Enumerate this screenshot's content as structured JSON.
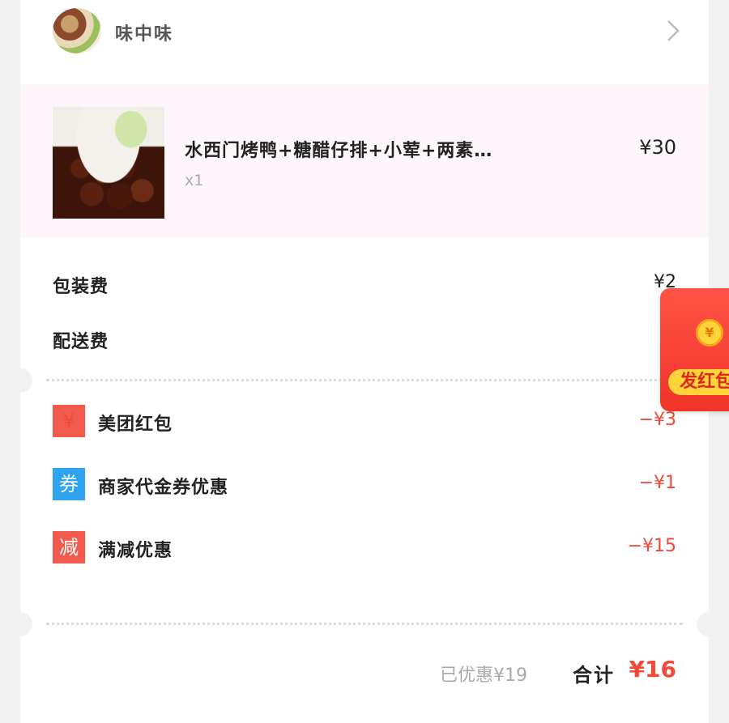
{
  "shop": {
    "name": "味中味"
  },
  "item": {
    "title": "水西门烤鸭+糖醋仔排+小荤+两素…",
    "quantity": "x1",
    "price": "¥30"
  },
  "fees": [
    {
      "label": "包装费",
      "value": "¥2"
    },
    {
      "label": "配送费",
      "value": "¥"
    }
  ],
  "discounts": [
    {
      "badge": "¥",
      "label": "美团红包",
      "value": "−¥3",
      "color": "#f25a4e"
    },
    {
      "badge": "券",
      "label": "商家代金券优惠",
      "value": "−¥1",
      "color": "#2ea4f0"
    },
    {
      "badge": "减",
      "label": "满减优惠",
      "value": "−¥15",
      "color": "#f25a4e"
    }
  ],
  "summary": {
    "saved": "已优惠¥19",
    "total_label": "合计",
    "total_value": "¥16"
  },
  "red_envelope": {
    "coin": "¥",
    "button": "发红包"
  },
  "colors": {
    "accent": "#f04a3a",
    "item_bg": "#fdf6fb"
  }
}
